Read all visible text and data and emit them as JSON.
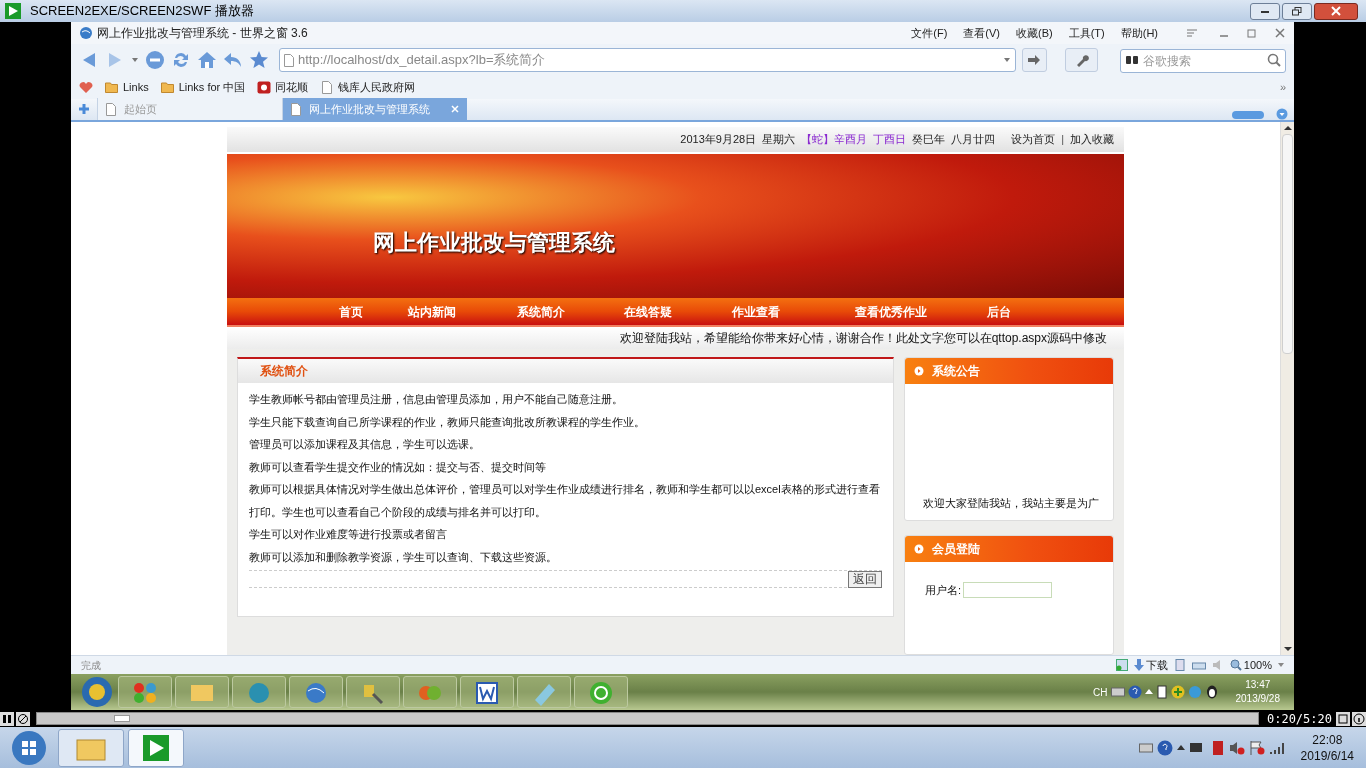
{
  "player": {
    "title": "SCREEN2EXE/SCREEN2SWF 播放器",
    "time": "0:20/5:20",
    "progress": {
      "level": 0.07
    }
  },
  "browser": {
    "title": "网上作业批改与管理系统 - 世界之窗 3.6",
    "menu": [
      "文件(F)",
      "查看(V)",
      "收藏(B)",
      "工具(T)",
      "帮助(H)"
    ],
    "address": "http://localhost/dx_detail.aspx?lb=系统简介",
    "search": {
      "placeholder": "谷歌搜索"
    },
    "bookmarks": [
      {
        "label": "Links",
        "kind": "folder"
      },
      {
        "label": "Links for 中国",
        "kind": "folder"
      },
      {
        "label": "同花顺",
        "kind": "app"
      },
      {
        "label": "钱库人民政府网",
        "kind": "page"
      }
    ],
    "tabs": [
      {
        "label": "起始页",
        "selected": false
      },
      {
        "label": "网上作业批改与管理系统",
        "selected": true
      }
    ],
    "overflow_chevron": "»",
    "status": "完成",
    "download": "下载",
    "zoom": "100%"
  },
  "page": {
    "date_parts": [
      {
        "text": "2013年9月28日",
        "highlight": false
      },
      {
        "text": "星期六",
        "highlight": false
      },
      {
        "text": "【蛇】辛酉月",
        "highlight": true
      },
      {
        "text": "丁酉日",
        "highlight": true
      },
      {
        "text": "癸巳年",
        "highlight": false
      },
      {
        "text": "八月廿四",
        "highlight": false
      }
    ],
    "top_links": [
      "设为首页",
      "加入收藏"
    ],
    "top_links_separator": "|",
    "banner_title": "网上作业批改与管理系统",
    "nav": [
      "首页",
      "站内新闻",
      "系统简介",
      "在线答疑",
      "作业查看",
      "查看优秀作业",
      "后台"
    ],
    "welcome": "欢迎登陆我站，希望能给你带来好心情，谢谢合作！此处文字您可以在qttop.aspx源码中修改",
    "section_title": "系统简介",
    "paragraphs": [
      "学生教师帐号都由管理员注册，信息由管理员添加，用户不能自己随意注册。",
      "学生只能下载查询自己所学课程的作业，教师只能查询批改所教课程的学生作业。",
      "管理员可以添加课程及其信息，学生可以选课。",
      "教师可以查看学生提交作业的情况如：提交与否、提交时间等",
      "教师可以根据具体情况对学生做出总体评价，管理员可以对学生作业成绩进行排名，教师和学生都可以以excel表格的形式进行查看打印。学生也可以查看自己个阶段的成绩与排名并可以打印。",
      "学生可以对作业难度等进行投票或者留言",
      "教师可以添加和删除教学资源，学生可以查询、下载这些资源。"
    ],
    "back_button": "返回",
    "notice_title": "系统公告",
    "notice_text": "欢迎大家登陆我站，我站主要是为广",
    "login_title": "会员登陆",
    "username_label": "用户名:"
  },
  "inner_taskbar": {
    "lang": "CH",
    "time": "13:47",
    "date": "2013/9/28"
  },
  "taskbar": {
    "time": "22:08",
    "date": "2019/6/14"
  }
}
